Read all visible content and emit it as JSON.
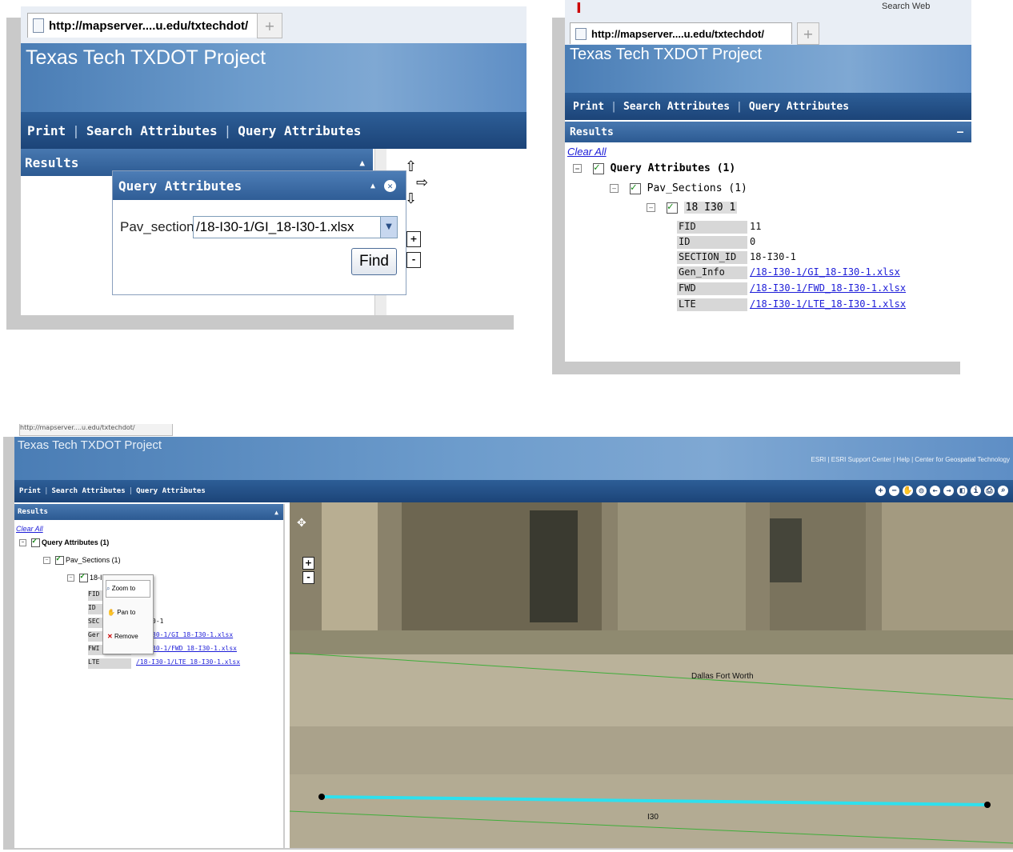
{
  "browser": {
    "url": "http://mapserver....u.edu/txtechdot/",
    "url_small": "http://mapserver....u.edu/txtechdot/",
    "new_tab": "+",
    "search_placeholder": "Search Web"
  },
  "app": {
    "title": "Texas Tech TXDOT Project",
    "nav": [
      "Print",
      "Search Attributes",
      "Query Attributes"
    ],
    "header_links": [
      "ESRI",
      "ESRI Support Center",
      "Help",
      "Center for Geospatial Technology"
    ]
  },
  "results": {
    "title": "Results",
    "clear_all": "Clear All",
    "tree": {
      "root": "Query Attributes (1)",
      "layer": "Pav_Sections (1)",
      "feature": "18 I30 1",
      "feature_short": "18-I"
    },
    "attributes": [
      {
        "key": "FID",
        "value": "11"
      },
      {
        "key": "ID",
        "value": "0"
      },
      {
        "key": "SECTION_ID",
        "value": "18-I30-1"
      },
      {
        "key": "Gen_Info",
        "value": "/18-I30-1/GI_18-I30-1.xlsx"
      },
      {
        "key": "FWD",
        "value": "/18-I30-1/FWD_18-I30-1.xlsx"
      },
      {
        "key": "LTE",
        "value": "/18-I30-1/LTE_18-I30-1.xlsx"
      }
    ],
    "attributes_cut": {
      "fid": "FID",
      "id": "ID",
      "sec": "SEC",
      "gen": "Ger",
      "fwd": "FWI",
      "lte": "LTE",
      "sec_val": "0-1",
      "gen_val": "30-1/GI_18-I30-1.xlsx",
      "fwd_val": "30-1/FWD_18-I30-1.xlsx",
      "lte_val": "/18-I30-1/LTE_18-I30-1.xlsx"
    }
  },
  "query_dialog": {
    "title": "Query Attributes",
    "field_label": "Pav_sections",
    "selected_value": "/18-I30-1/GI_18-I30-1.xlsx",
    "find_button": "Find"
  },
  "context_menu": {
    "items": [
      "Zoom to",
      "Pan to",
      "Remove"
    ]
  },
  "map": {
    "label_city": "Dallas Fort Worth",
    "label_road": "I30",
    "zoom_in": "+",
    "zoom_out": "-",
    "highlight_color": "#2ee0ee",
    "boundary_color": "#3fae3a"
  }
}
